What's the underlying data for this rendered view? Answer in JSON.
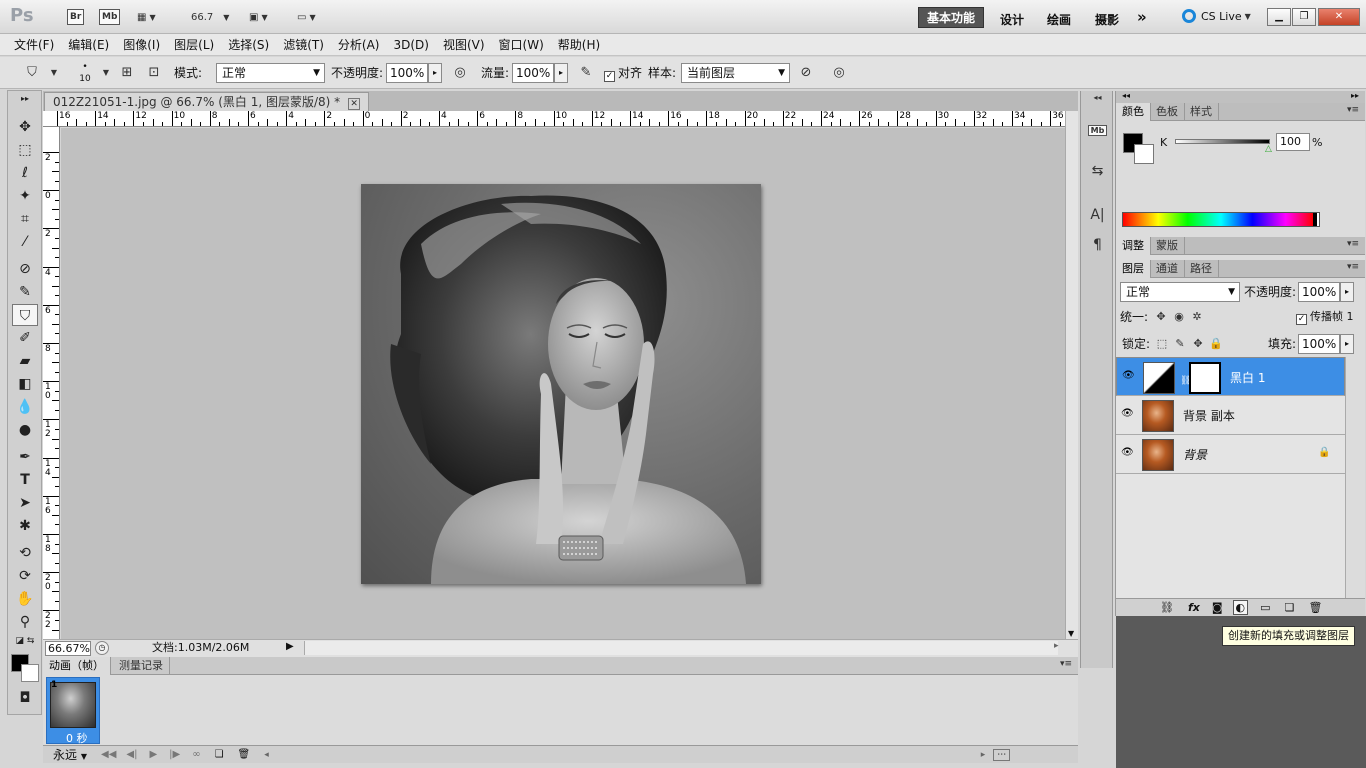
{
  "app": {
    "logo": "Ps",
    "zoom_menu": "66.7",
    "bridge_label": "Br",
    "minibridge_label": "Mb",
    "workspaces": [
      "基本功能",
      "设计",
      "绘画",
      "摄影"
    ],
    "active_workspace": "基本功能",
    "more_workspaces": "»",
    "cs_live": "CS Live"
  },
  "menu": [
    "文件(F)",
    "编辑(E)",
    "图像(I)",
    "图层(L)",
    "选择(S)",
    "滤镜(T)",
    "分析(A)",
    "3D(D)",
    "视图(V)",
    "窗口(W)",
    "帮助(H)"
  ],
  "options": {
    "brush_size": "10",
    "mode_label": "模式:",
    "mode_value": "正常",
    "opacity_label": "不透明度:",
    "opacity_value": "100%",
    "flow_label": "流量:",
    "flow_value": "100%",
    "aligned_label": "对齐",
    "sample_label": "样本:",
    "sample_value": "当前图层"
  },
  "document": {
    "tab_title": "012Z21051-1.jpg @ 66.7% (黑白 1, 图层蒙版/8) *",
    "ruler_top": [
      "16",
      "14",
      "12",
      "10",
      "8",
      "6",
      "4",
      "2",
      "0",
      "2",
      "4",
      "6",
      "8",
      "10",
      "12",
      "14",
      "16",
      "18",
      "20",
      "22",
      "24",
      "26",
      "28",
      "30",
      "32",
      "34",
      "36"
    ],
    "ruler_left": [
      "2",
      "0",
      "2",
      "4",
      "6",
      "8",
      "10",
      "12",
      "14",
      "16",
      "18",
      "20",
      "22"
    ],
    "zoom": "66.67%",
    "doc_info": "文档:1.03M/2.06M"
  },
  "animation": {
    "tabs": [
      "动画（帧）",
      "测量记录"
    ],
    "frame_number": "1",
    "frame_delay": "0 秒",
    "loop": "永远"
  },
  "color_panel": {
    "tabs": [
      "颜色",
      "色板",
      "样式"
    ],
    "channel_label": "K",
    "k_value": "100",
    "percent": "%",
    "k_level": 1.0
  },
  "adjust_panel": {
    "tabs": [
      "调整",
      "蒙版"
    ]
  },
  "layers_panel": {
    "tabs": [
      "图层",
      "通道",
      "路径"
    ],
    "blend_mode": "正常",
    "opacity_label": "不透明度:",
    "opacity_value": "100%",
    "unify_label": "统一:",
    "propagate_label": "传播帧 1",
    "lock_label": "锁定:",
    "fill_label": "填充:",
    "fill_value": "100%",
    "layers": [
      {
        "name": "黑白 1",
        "selected": true
      },
      {
        "name": "背景 副本",
        "selected": false
      },
      {
        "name": "背景",
        "selected": false,
        "locked": true
      }
    ]
  },
  "tooltip": "创建新的填充或调整图层",
  "colors": {
    "accent": "#3d8ee5",
    "canvas_bg": "#c0c0c0"
  }
}
